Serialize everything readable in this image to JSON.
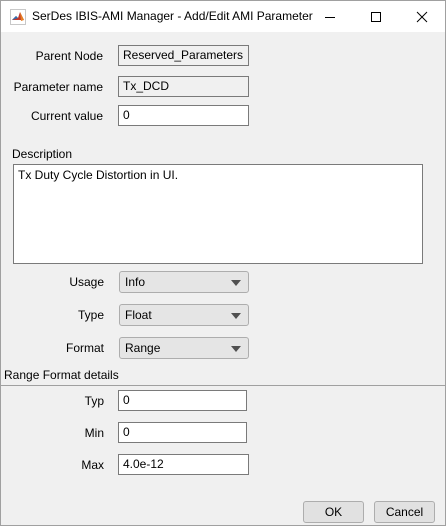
{
  "window": {
    "title": "SerDes IBIS-AMI Manager - Add/Edit AMI Parameter"
  },
  "form": {
    "parent_node_label": "Parent Node",
    "parent_node_value": "Reserved_Parameters",
    "parameter_name_label": "Parameter name",
    "parameter_name_value": "Tx_DCD",
    "current_value_label": "Current value",
    "current_value_value": "0",
    "description_label": "Description",
    "description_value": "Tx Duty Cycle Distortion in UI.",
    "usage_label": "Usage",
    "usage_value": "Info",
    "type_label": "Type",
    "type_value": "Float",
    "format_label": "Format",
    "format_value": "Range"
  },
  "range": {
    "section_label": "Range Format details",
    "typ_label": "Typ",
    "typ_value": "0",
    "min_label": "Min",
    "min_value": "0",
    "max_label": "Max",
    "max_value": "4.0e-12"
  },
  "buttons": {
    "ok_label": "OK",
    "cancel_label": "Cancel"
  },
  "icons": {
    "app": "matlab-icon",
    "minimize": "minimize-icon",
    "maximize": "maximize-icon",
    "close": "close-icon"
  }
}
